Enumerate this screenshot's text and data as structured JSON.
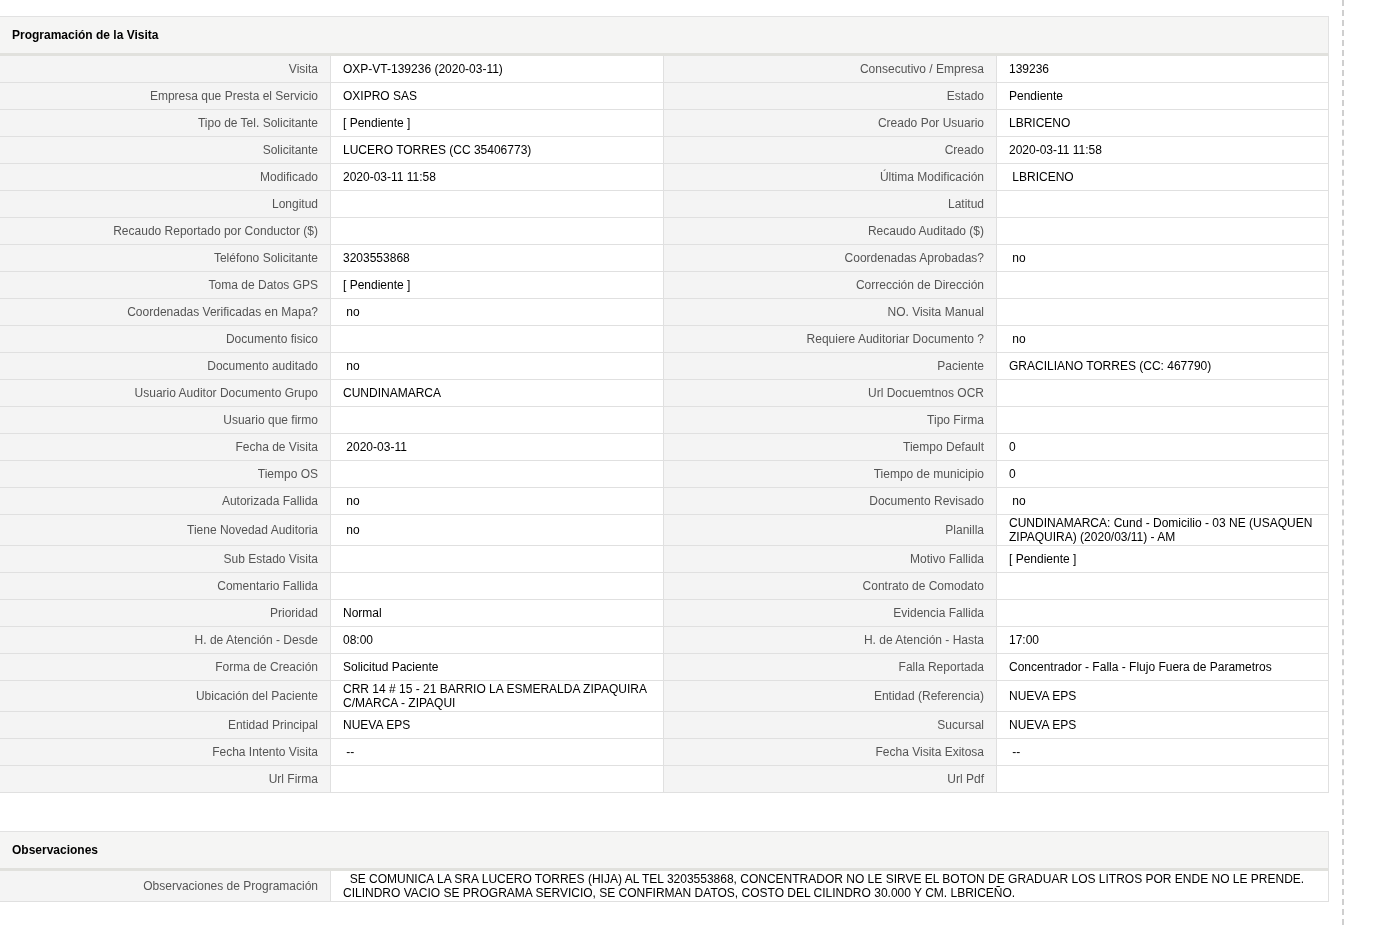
{
  "sections": [
    {
      "title": "Programación de la Visita",
      "rows": [
        [
          {
            "label": "Visita",
            "value": "OXP-VT-139236 (2020-03-11)"
          },
          {
            "label": "Consecutivo / Empresa",
            "value": "139236"
          }
        ],
        [
          {
            "label": "Empresa que Presta el Servicio",
            "value": "OXIPRO SAS"
          },
          {
            "label": "Estado",
            "value": "Pendiente"
          }
        ],
        [
          {
            "label": "Tipo de Tel. Solicitante",
            "value": "[ Pendiente ]"
          },
          {
            "label": "Creado Por Usuario",
            "value": "LBRICENO"
          }
        ],
        [
          {
            "label": "Solicitante",
            "value": "LUCERO TORRES (CC 35406773)"
          },
          {
            "label": "Creado",
            "value": "2020-03-11 11:58"
          }
        ],
        [
          {
            "label": "Modificado",
            "value": "2020-03-11 11:58"
          },
          {
            "label": "Última Modificación",
            "value": " LBRICENO"
          }
        ],
        [
          {
            "label": "Longitud"
          },
          {
            "label": "Latitud"
          }
        ],
        [
          {
            "label": "Recaudo Reportado por Conductor ($)"
          },
          {
            "label": "Recaudo Auditado ($)"
          }
        ],
        [
          {
            "label": "Teléfono Solicitante",
            "value": "3203553868"
          },
          {
            "label": "Coordenadas Aprobadas?",
            "value": " no"
          }
        ],
        [
          {
            "label": "Toma de Datos GPS",
            "value": "[ Pendiente ]"
          },
          {
            "label": "Corrección de Dirección"
          }
        ],
        [
          {
            "label": "Coordenadas Verificadas en Mapa?",
            "value": " no"
          },
          {
            "label": "NO. Visita Manual"
          }
        ],
        [
          {
            "label": "Documento fisico"
          },
          {
            "label": "Requiere Auditoriar Documento ?",
            "value": " no"
          }
        ],
        [
          {
            "label": "Documento auditado",
            "value": " no"
          },
          {
            "label": "Paciente",
            "value": "GRACILIANO TORRES (CC: 467790)"
          }
        ],
        [
          {
            "label": "Usuario Auditor Documento Grupo",
            "value": "CUNDINAMARCA"
          },
          {
            "label": "Url Docuemtnos OCR"
          }
        ],
        [
          {
            "label": "Usuario que firmo"
          },
          {
            "label": "Tipo Firma"
          }
        ],
        [
          {
            "label": "Fecha de Visita",
            "value": " 2020-03-11"
          },
          {
            "label": "Tiempo Default",
            "value": "0"
          }
        ],
        [
          {
            "label": "Tiempo OS"
          },
          {
            "label": "Tiempo de municipio",
            "value": "0"
          }
        ],
        [
          {
            "label": "Autorizada Fallida",
            "value": " no"
          },
          {
            "label": "Documento Revisado",
            "value": " no"
          }
        ],
        [
          {
            "label": "Tiene Novedad Auditoria",
            "value": " no"
          },
          {
            "label": "Planilla",
            "value": "CUNDINAMARCA: Cund - Domicilio - 03 NE (USAQUEN ZIPAQUIRA) (2020/03/11) - AM"
          }
        ],
        [
          {
            "label": "Sub Estado Visita"
          },
          {
            "label": "Motivo Fallida",
            "value": "[ Pendiente ]"
          }
        ],
        [
          {
            "label": "Comentario Fallida"
          },
          {
            "label": "Contrato de Comodato"
          }
        ],
        [
          {
            "label": "Prioridad",
            "value": "Normal"
          },
          {
            "label": "Evidencia Fallida"
          }
        ],
        [
          {
            "label": "H. de Atención - Desde",
            "value": "08:00"
          },
          {
            "label": "H. de Atención - Hasta",
            "value": "17:00"
          }
        ],
        [
          {
            "label": "Forma de Creación",
            "value": "Solicitud Paciente"
          },
          {
            "label": "Falla Reportada",
            "value": "Concentrador - Falla - Flujo Fuera de Parametros"
          }
        ],
        [
          {
            "label": "Ubicación del Paciente",
            "value": "CRR 14 # 15 - 21 BARRIO LA ESMERALDA ZIPAQUIRA C/MARCA - ZIPAQUI"
          },
          {
            "label": "Entidad (Referencia)",
            "value": "NUEVA EPS"
          }
        ],
        [
          {
            "label": "Entidad Principal",
            "value": "NUEVA EPS"
          },
          {
            "label": "Sucursal",
            "value": "NUEVA EPS"
          }
        ],
        [
          {
            "label": "Fecha Intento Visita",
            "value": " --"
          },
          {
            "label": "Fecha Visita Exitosa",
            "value": " --"
          }
        ],
        [
          {
            "label": "Url Firma"
          },
          {
            "label": "Url Pdf"
          }
        ]
      ]
    },
    {
      "title": "Observaciones",
      "rows": [
        [
          {
            "label": "Observaciones de Programación",
            "value": "  SE COMUNICA LA SRA LUCERO TORRES (HIJA) AL TEL 3203553868, CONCENTRADOR NO LE SIRVE EL BOTON DE GRADUAR LOS LITROS POR ENDE NO LE PRENDE. CILINDRO VACIO SE PROGRAMA SERVICIO, SE CONFIRMAN DATOS, COSTO DEL CILINDRO 30.000 Y CM. LBRICEÑO."
          }
        ]
      ]
    }
  ]
}
